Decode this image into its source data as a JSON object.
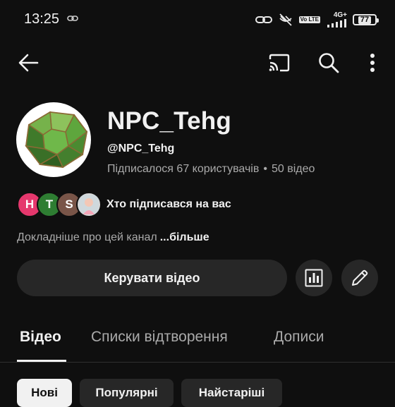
{
  "status_bar": {
    "time": "13:25",
    "network": "4G+",
    "volte": "Vo LTE",
    "battery": "77"
  },
  "top_bar": {
    "icons": [
      "arrow-left-icon",
      "cast-icon",
      "search-icon",
      "more-vertical-icon"
    ]
  },
  "channel": {
    "name": "NPC_Tehg",
    "handle": "@NPC_Tehg",
    "subscribers": "Підписалося 67 користувачів",
    "separator": "•",
    "videos": "50 відео",
    "description": "Докладніше про цей канал",
    "more_label": "...більше"
  },
  "subscribers_row": {
    "avatars": [
      {
        "letter": "H",
        "color": "#e5386d"
      },
      {
        "letter": "T",
        "color": "#2e7d32"
      },
      {
        "letter": "S",
        "color": "#795548"
      },
      {
        "letter": "",
        "color": "#d9d9d9"
      }
    ],
    "label": "Хто підписався на вас"
  },
  "actions": {
    "manage_label": "Керувати відео",
    "icons": [
      "analytics-icon",
      "pencil-icon"
    ]
  },
  "tabs": [
    {
      "label": "Відео",
      "active": true
    },
    {
      "label": "Списки відтворення",
      "active": false
    },
    {
      "label": "Дописи",
      "active": false
    }
  ],
  "chips": [
    {
      "label": "Нові",
      "selected": true
    },
    {
      "label": "Популярні",
      "selected": false
    },
    {
      "label": "Найстаріші",
      "selected": false
    }
  ],
  "colors": {
    "background": "#0f0f0f",
    "surface": "#272727",
    "text_primary": "#f1f1f1",
    "text_secondary": "#aaaaaa",
    "avatar_shape": "#5aa03c"
  }
}
